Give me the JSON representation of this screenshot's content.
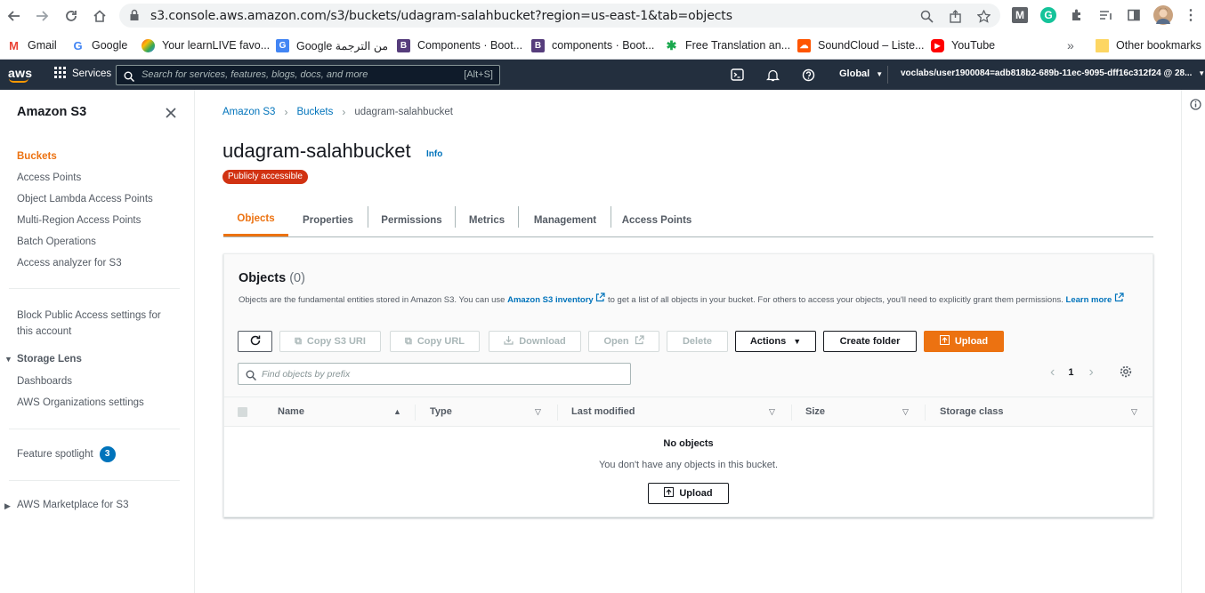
{
  "browser": {
    "url": "s3.console.aws.amazon.com/s3/buckets/udagram-salahbucket?region=us-east-1&tab=objects",
    "bookmarks": [
      {
        "label": "Gmail",
        "icon": "gmail-icon"
      },
      {
        "label": "Google",
        "icon": "google-icon"
      },
      {
        "label": "Your learnLIVE favo...",
        "icon": "learnlive-icon"
      },
      {
        "label": "Google من الترجمة",
        "icon": "google-translate-icon"
      },
      {
        "label": "Components · Boot...",
        "icon": "bootstrap-icon"
      },
      {
        "label": "components · Boot...",
        "icon": "bootstrap-icon"
      },
      {
        "label": "Free Translation an...",
        "icon": "translation-icon"
      },
      {
        "label": "SoundCloud – Liste...",
        "icon": "soundcloud-icon"
      },
      {
        "label": "YouTube",
        "icon": "youtube-icon"
      }
    ],
    "overflow": "»",
    "other_bookmarks": "Other bookmarks"
  },
  "aws_header": {
    "logo": "aws",
    "services": "Services",
    "search_placeholder": "Search for services, features, blogs, docs, and more",
    "search_shortcut": "[Alt+S]",
    "region": "Global",
    "account": "voclabs/user1900084=adb818b2-689b-11ec-9095-dff16c312f24 @ 28..."
  },
  "sidebar": {
    "title": "Amazon S3",
    "items": [
      "Buckets",
      "Access Points",
      "Object Lambda Access Points",
      "Multi-Region Access Points",
      "Batch Operations",
      "Access analyzer for S3"
    ],
    "block_public_access": [
      "Block Public Access settings for",
      "this account"
    ],
    "storage_lens": {
      "title": "Storage Lens",
      "items": [
        "Dashboards",
        "AWS Organizations settings"
      ]
    },
    "feature_spotlight": "Feature spotlight",
    "feature_spotlight_count": "3",
    "marketplace": "AWS Marketplace for S3"
  },
  "main": {
    "breadcrumb": [
      "Amazon S3",
      "Buckets",
      "udagram-salahbucket"
    ],
    "title": "udagram-salahbucket",
    "info": "Info",
    "badge": "Publicly accessible",
    "tabs": [
      "Objects",
      "Properties",
      "Permissions",
      "Metrics",
      "Management",
      "Access Points"
    ]
  },
  "objects": {
    "title": "Objects",
    "count": "(0)",
    "desc_1": "Objects are the fundamental entities stored in Amazon S3. You can use ",
    "desc_link": "Amazon S3 inventory",
    "desc_2": " to get a list of all objects in your bucket. For others to access your objects, you'll need to explicitly grant them permissions. ",
    "learn_more": "Learn more",
    "buttons": {
      "copy_s3_uri": "Copy S3 URI",
      "copy_url": "Copy URL",
      "download": "Download",
      "open": "Open",
      "delete": "Delete",
      "actions": "Actions",
      "create_folder": "Create folder",
      "upload": "Upload"
    },
    "search_placeholder": "Find objects by prefix",
    "page": "1",
    "columns": [
      "Name",
      "Type",
      "Last modified",
      "Size",
      "Storage class"
    ],
    "empty_title": "No objects",
    "empty_text": "You don't have any objects in this bucket.",
    "empty_upload": "Upload"
  },
  "colors": {
    "aws_orange": "#ec7211",
    "aws_header": "#232f3e",
    "link": "#0073bb",
    "danger": "#d13212"
  }
}
